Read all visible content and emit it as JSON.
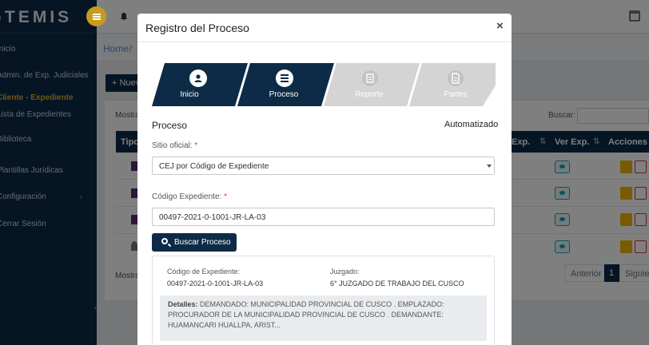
{
  "brand": {
    "name": "TEMIS"
  },
  "sidebar": {
    "items": [
      {
        "label": "Inicio"
      },
      {
        "label": "Admin. de Exp. Judiciales"
      },
      {
        "label": "Cliente - Expediente"
      },
      {
        "label": "Lista de Expedientes"
      },
      {
        "label": "Biblioteca"
      },
      {
        "label": "Plantillas Jurídicas"
      },
      {
        "label": "Configuración"
      },
      {
        "label": "Cerrar Sesión"
      }
    ]
  },
  "breadcrumb": {
    "home": "Home",
    "separator": "/"
  },
  "page": {
    "new_button": "+ Nuevo",
    "show_label_top": "Mostrar",
    "show_label_bottom": "Mostrar",
    "search_label": "Buscar:",
    "table_headers": {
      "tipo": "Tipo",
      "exp": "Exp.",
      "ver_exp": "Ver Exp.",
      "acciones": "Acciones"
    },
    "pagination": {
      "prev": "Anterior",
      "current": "1",
      "next": "Siguiente"
    }
  },
  "modal": {
    "title": "Registro del Proceso",
    "close": "×",
    "steps": [
      {
        "label": "Inicio",
        "icon": "user-icon"
      },
      {
        "label": "Proceso",
        "icon": "list-icon"
      },
      {
        "label": "Reporte",
        "icon": "file-icon"
      },
      {
        "label": "Partes",
        "icon": "document-icon"
      }
    ],
    "section_title": "Proceso",
    "section_mode": "Automatizado",
    "sitio_label": "Sitio oficial:",
    "required_mark": "*",
    "sitio_value": "CEJ por Código de Expediente",
    "codigo_label": "Código Expediente:",
    "codigo_value": "00497-2021-0-1001-JR-LA-03",
    "search_button": "Buscar Proceso",
    "result": {
      "codigo_label": "Código de Expediente:",
      "codigo_value": "00497-2021-0-1001-JR-LA-03",
      "juzgado_label": "Juzgado:",
      "juzgado_value": "6° JUZGADO DE TRABAJO DEL CUSCO",
      "details_label": "Detalles:",
      "details_text": "DEMANDADO: MUNICIPALIDAD PROVINCIAL DE CUSCO . EMPLAZADO: PROCURADOR DE LA MUNICIPALIDAD PROVINCIAL DE CUSCO . DEMANDANTE: HUAMANCARI HUALLPA, ARIST..."
    }
  },
  "colors": {
    "navy": "#0d2b46",
    "accent_gold": "#c99a1c",
    "active_menu": "#e0a82e",
    "step_inactive": "#d4d4d4"
  }
}
